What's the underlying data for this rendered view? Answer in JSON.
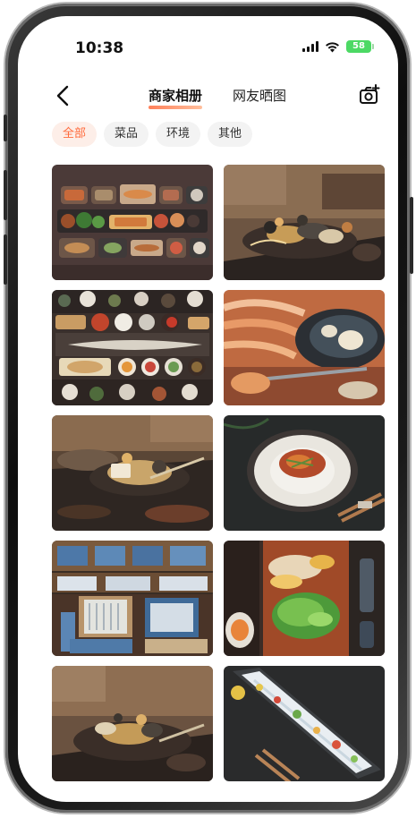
{
  "status_bar": {
    "time": "10:38",
    "battery": "58"
  },
  "nav": {
    "tabs": [
      {
        "label": "商家相册",
        "active": true
      },
      {
        "label": "网友晒图",
        "active": false
      }
    ]
  },
  "filters": [
    {
      "label": "全部",
      "active": true
    },
    {
      "label": "菜品",
      "active": false
    },
    {
      "label": "环境",
      "active": false
    },
    {
      "label": "其他",
      "active": false
    }
  ],
  "colors": {
    "accent": "#ff6b3d",
    "chip_active_bg": "#fdeee8",
    "battery": "#4cd964"
  },
  "icons": [
    "back-arrow-icon",
    "signal-icon",
    "wifi-icon",
    "battery-icon",
    "camera-add-icon"
  ]
}
